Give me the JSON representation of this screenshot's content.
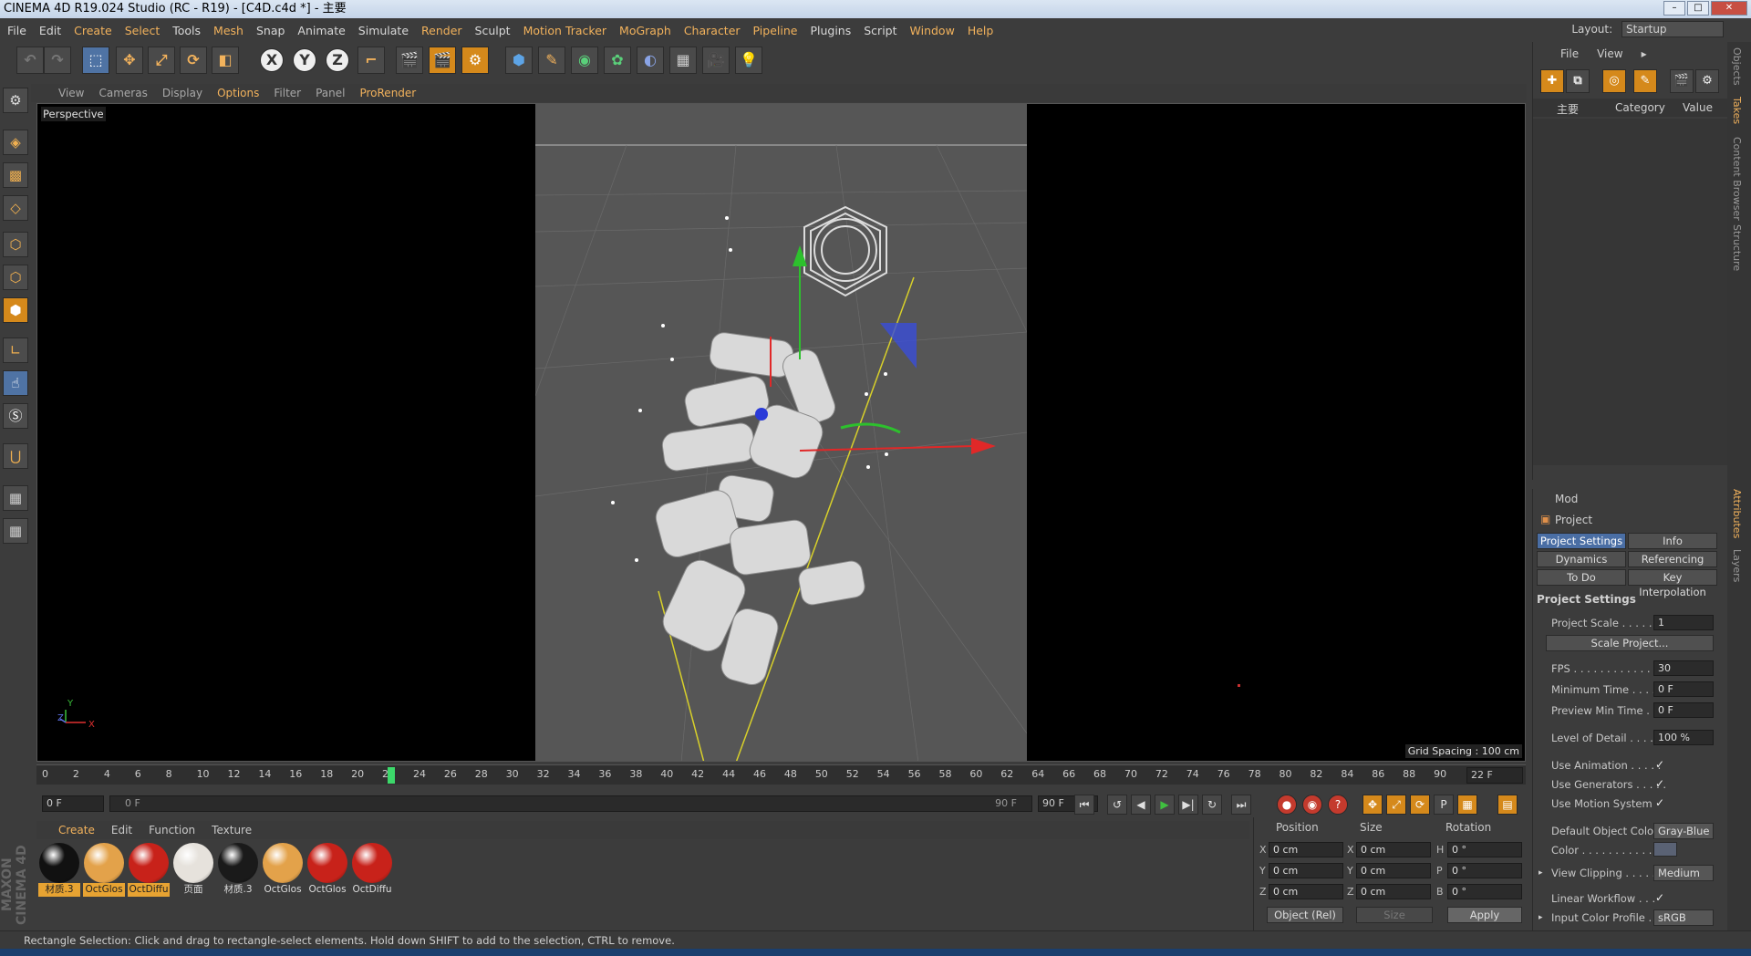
{
  "window": {
    "title": "CINEMA 4D R19.024 Studio (RC - R19) - [C4D.c4d *] - 主要"
  },
  "menu": [
    "File",
    "Edit",
    "Create",
    "Select",
    "Tools",
    "Mesh",
    "Snap",
    "Animate",
    "Simulate",
    "Render",
    "Sculpt",
    "Motion Tracker",
    "MoGraph",
    "Character",
    "Pipeline",
    "Plugins",
    "Script",
    "Window",
    "Help"
  ],
  "layout": {
    "label": "Layout:",
    "value": "Startup"
  },
  "toolbar": {
    "x": "X",
    "y": "Y",
    "z": "Z"
  },
  "viewport": {
    "menu": [
      "View",
      "Cameras",
      "Display",
      "Options",
      "Filter",
      "Panel",
      "ProRender"
    ],
    "label": "Perspective",
    "grid_spacing": "Grid Spacing : 100 cm",
    "axis_y": "Y",
    "axis_x": "X",
    "axis_z": "Z"
  },
  "timeline": {
    "ticks": [
      "0",
      "2",
      "4",
      "6",
      "8",
      "10",
      "12",
      "14",
      "16",
      "18",
      "20",
      "22",
      "24",
      "26",
      "28",
      "30",
      "32",
      "34",
      "36",
      "38",
      "40",
      "42",
      "44",
      "46",
      "48",
      "50",
      "52",
      "54",
      "56",
      "58",
      "60",
      "62",
      "64",
      "66",
      "68",
      "70",
      "72",
      "74",
      "76",
      "78",
      "80",
      "82",
      "84",
      "86",
      "88",
      "90"
    ],
    "current_frame": "22 F",
    "start": "0 F",
    "range_start": "0 F",
    "range_end": "90 F",
    "end": "90 F"
  },
  "materials": {
    "menu": [
      "Create",
      "Edit",
      "Function",
      "Texture"
    ],
    "items": [
      {
        "label": "材质.3",
        "color": "#111111",
        "selected": true
      },
      {
        "label": "OctGlos",
        "color": "#e3a24a",
        "selected": true
      },
      {
        "label": "OctDiffu",
        "color": "#c8221a",
        "selected": true
      },
      {
        "label": "页面",
        "color": "#e6e2dc",
        "selected": false
      },
      {
        "label": "材质.3",
        "color": "#1a1a1a",
        "selected": false
      },
      {
        "label": "OctGlos",
        "color": "#e3a24a",
        "selected": false
      },
      {
        "label": "OctGlos",
        "color": "#c8221a",
        "selected": false
      },
      {
        "label": "OctDiffu",
        "color": "#c8221a",
        "selected": false
      }
    ]
  },
  "coords": {
    "headers": [
      "Position",
      "Size",
      "Rotation"
    ],
    "rows": [
      {
        "a": "X",
        "pos": "0 cm",
        "b": "X",
        "size": "0 cm",
        "c": "H",
        "rot": "0 °"
      },
      {
        "a": "Y",
        "pos": "0 cm",
        "b": "Y",
        "size": "0 cm",
        "c": "P",
        "rot": "0 °"
      },
      {
        "a": "Z",
        "pos": "0 cm",
        "b": "Z",
        "size": "0 cm",
        "c": "B",
        "rot": "0 °"
      }
    ],
    "mode": "Object (Rel)",
    "size_mode": "Size",
    "apply": "Apply"
  },
  "objects": {
    "menu": [
      "File",
      "View"
    ],
    "col_name": "主要",
    "col_category": "Category",
    "col_value": "Value"
  },
  "attributes": {
    "mode": "Mod",
    "title": "Project",
    "tabs": [
      "Project Settings",
      "Info",
      "Dynamics",
      "Referencing",
      "To Do",
      "Key Interpolation"
    ],
    "section": "Project Settings",
    "project_scale_label": "Project Scale . . . . . . .",
    "project_scale": "1",
    "scale_project": "Scale Project...",
    "fps_label": "FPS . . . . . . . . . . . . . . .",
    "fps": "30",
    "min_time_label": "Minimum Time . . . . .",
    "min_time": "0 F",
    "preview_min_label": "Preview Min Time . . .",
    "preview_min": "0 F",
    "lod_label": "Level of Detail . . . . .",
    "lod": "100 %",
    "use_anim_label": "Use Animation . . . . .",
    "use_gen_label": "Use Generators . . . . .",
    "use_motion_label": "Use Motion System",
    "check": "✓",
    "def_color_label": "Default Object Color",
    "def_color": "Gray-Blue",
    "color_label": "Color . . . . . . . . . . .",
    "clipping_label": "View Clipping . . . . . .",
    "clipping": "Medium",
    "linear_label": "Linear Workflow . . .",
    "profile_label": "Input Color Profile . .",
    "profile": "sRGB"
  },
  "vtabs": [
    "Objects",
    "Takes",
    "Content Browser",
    "Structure",
    "Attributes",
    "Layers"
  ],
  "status": "Rectangle Selection: Click and drag to rectangle-select elements. Hold down SHIFT to add to the selection, CTRL to remove.",
  "maxon": "MAXON CINEMA 4D"
}
